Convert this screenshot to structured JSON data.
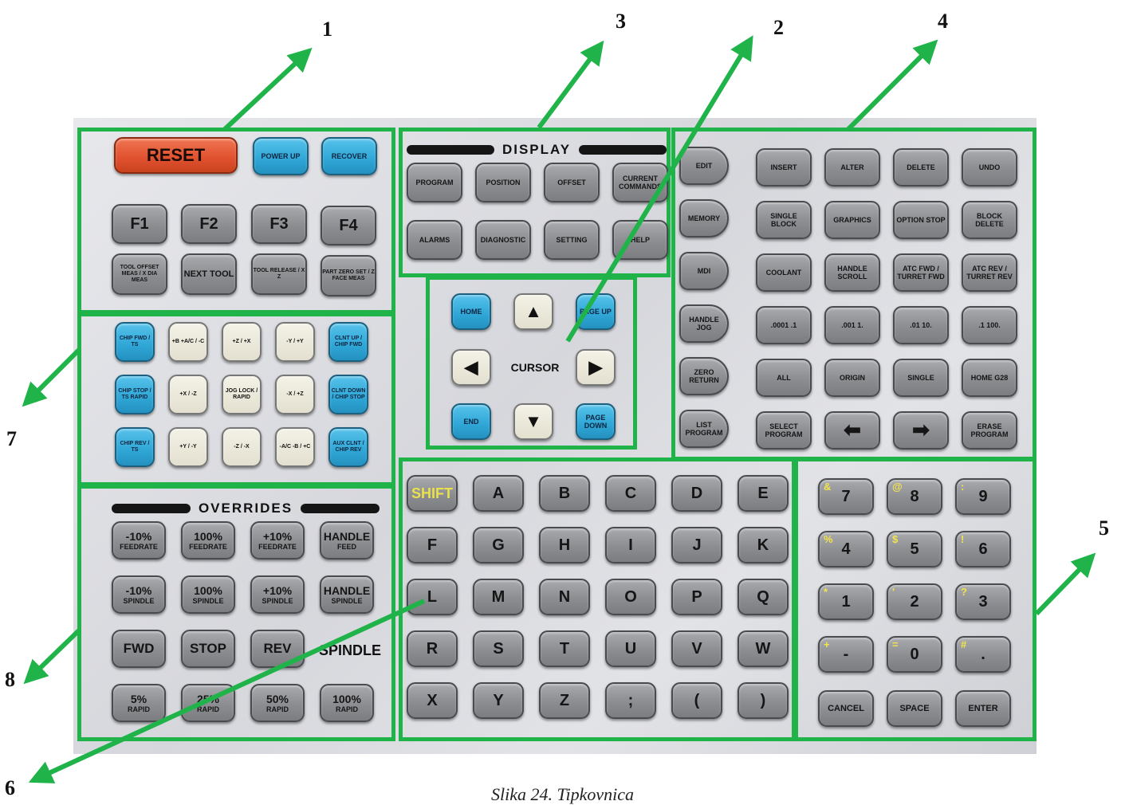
{
  "callouts": [
    "1",
    "3",
    "2",
    "4",
    "5",
    "6",
    "7",
    "8"
  ],
  "caption": "Slika 24. Tipkovnica",
  "colors": {
    "frame": "#1fb34a",
    "blue_key": "#2fa6d6",
    "reset_key": "#e0502e",
    "shift_text": "#e9e04d"
  },
  "section1": {
    "reset": "RESET",
    "power_up": "POWER UP",
    "recover": "RECOVER",
    "f1": "F1",
    "f2": "F2",
    "f3": "F3",
    "f4": "F4",
    "tool_offset_meas": "TOOL OFFSET MEAS / X DIA MEAS",
    "next_tool": "NEXT TOOL",
    "tool_release": "TOOL RELEASE / X Z",
    "part_zero_set": "PART ZERO SET / Z FACE MEAS"
  },
  "display": {
    "header": "DISPLAY",
    "keys": [
      "PROGRAM",
      "POSITION",
      "OFFSET",
      "CURRENT COMMANDS",
      "ALARMS",
      "DIAGNOSTIC",
      "SETTING",
      "HELP"
    ]
  },
  "cursor": {
    "label": "CURSOR",
    "home": "HOME",
    "page_up": "PAGE UP",
    "end": "END",
    "page_down": "PAGE DOWN",
    "up_icon": "up-arrow-icon",
    "down_icon": "down-arrow-icon",
    "left_icon": "left-arrow-icon",
    "right_icon": "right-arrow-icon"
  },
  "edit": {
    "mode_keys": [
      "EDIT",
      "MEMORY",
      "MDI",
      "HANDLE JOG",
      "ZERO RETURN",
      "LIST PROGRAM"
    ],
    "rows": [
      [
        "INSERT",
        "ALTER",
        "DELETE",
        "UNDO"
      ],
      [
        "SINGLE BLOCK",
        "GRAPHICS",
        "OPTION STOP",
        "BLOCK DELETE"
      ],
      [
        "COOLANT",
        "HANDLE SCROLL",
        "ATC FWD / TURRET FWD",
        "ATC REV / TURRET REV"
      ],
      [
        ".0001 .1",
        ".001 1.",
        ".01 10.",
        ".1 100."
      ],
      [
        "ALL",
        "ORIGIN",
        "SINGLE",
        "HOME G28"
      ],
      [
        "SELECT PROGRAM",
        "",
        "",
        "ERASE PROGRAM"
      ]
    ]
  },
  "jog": {
    "rows": [
      [
        "CHIP FWD / TS",
        "+B +A/C / -C",
        "+Z / +X",
        "-Y / +Y",
        "CLNT UP / CHIP FWD"
      ],
      [
        "CHIP STOP / TS RAPID",
        "+X / -Z",
        "JOG LOCK / RAPID",
        "-X / +Z",
        "CLNT DOWN / CHIP STOP"
      ],
      [
        "CHIP REV / TS",
        "+Y / -Y",
        "-Z / -X",
        "-A/C -B / +C",
        "AUX CLNT / CHIP REV"
      ]
    ]
  },
  "overrides": {
    "header": "OVERRIDES",
    "rows": [
      [
        [
          "-10%",
          "FEEDRATE"
        ],
        [
          "100%",
          "FEEDRATE"
        ],
        [
          "+10%",
          "FEEDRATE"
        ],
        [
          "HANDLE",
          "FEED"
        ]
      ],
      [
        [
          "-10%",
          "SPINDLE"
        ],
        [
          "100%",
          "SPINDLE"
        ],
        [
          "+10%",
          "SPINDLE"
        ],
        [
          "HANDLE",
          "SPINDLE"
        ]
      ],
      [
        [
          "FWD",
          ""
        ],
        [
          "STOP",
          ""
        ],
        [
          "REV",
          ""
        ]
      ],
      [
        [
          "5%",
          "RAPID"
        ],
        [
          "25%",
          "RAPID"
        ],
        [
          "50%",
          "RAPID"
        ],
        [
          "100%",
          "RAPID"
        ]
      ]
    ],
    "spindle_label": "SPINDLE"
  },
  "alpha": {
    "rows": [
      [
        "SHIFT",
        "A",
        "B",
        "C",
        "D",
        "E"
      ],
      [
        "F",
        "G",
        "H",
        "I",
        "J",
        "K"
      ],
      [
        "L",
        "M",
        "N",
        "O",
        "P",
        "Q"
      ],
      [
        "R",
        "S",
        "T",
        "U",
        "V",
        "W"
      ],
      [
        "X",
        "Y",
        "Z",
        ";",
        "(",
        ")"
      ]
    ]
  },
  "numeric": {
    "rows": [
      [
        [
          "&",
          "7"
        ],
        [
          "@",
          "8"
        ],
        [
          ":",
          "9"
        ]
      ],
      [
        [
          "%",
          "4"
        ],
        [
          "$",
          "5"
        ],
        [
          "!",
          "6"
        ]
      ],
      [
        [
          "*",
          "1"
        ],
        [
          "'",
          "2"
        ],
        [
          "?",
          "3"
        ]
      ],
      [
        [
          "+",
          "-"
        ],
        [
          "=",
          "0"
        ],
        [
          "#",
          "."
        ]
      ]
    ],
    "bottom": [
      "CANCEL",
      "SPACE",
      "ENTER"
    ]
  }
}
